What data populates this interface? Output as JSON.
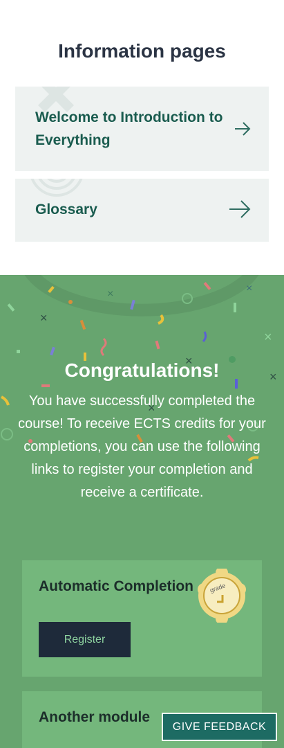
{
  "info": {
    "title": "Information pages",
    "pages": [
      {
        "label": "Welcome to Introduction to Everything"
      },
      {
        "label": "Glossary"
      }
    ]
  },
  "congrats": {
    "title": "Congratulations!",
    "body": "You have successfully completed the course! To receive ECTS credits for your completions, you can use the following links to register your completion and receive a certificate."
  },
  "modules": [
    {
      "title": "Automatic Completion",
      "button": "Register",
      "badge_text": "grade"
    },
    {
      "title": "Another module"
    }
  ],
  "feedback_button": "GIVE FEEDBACK",
  "colors": {
    "heading": "#2b3444",
    "link_text": "#1a5c4f",
    "card_bg": "#eef2f1",
    "congrats_bg": "#67a56f",
    "module_bg": "#74b77c",
    "register_bg": "#1e2a3a",
    "feedback_bg": "#1d6b63"
  },
  "icons": [
    "arrow-right-icon",
    "grade-badge-icon",
    "confetti"
  ]
}
